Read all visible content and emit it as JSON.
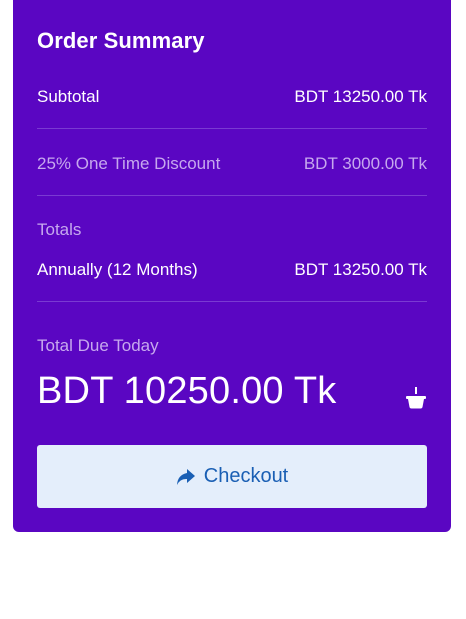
{
  "summary": {
    "title": "Order Summary",
    "subtotal": {
      "label": "Subtotal",
      "amount": "BDT 13250.00 Tk"
    },
    "discount": {
      "label": "25% One Time Discount",
      "amount": "BDT 3000.00 Tk"
    },
    "totals_label": "Totals",
    "annual": {
      "label": "Annually (12 Months)",
      "amount": "BDT 13250.00 Tk"
    },
    "due_label": "Total Due Today",
    "due_amount": "BDT 10250.00 Tk",
    "basket_icon": "basket-icon",
    "checkout_label": "Checkout",
    "checkout_icon": "share-arrow-icon"
  },
  "colors": {
    "card_bg": "#5a06c2",
    "muted_text": "#c6a8ee",
    "button_bg": "#e4eefb",
    "button_text": "#1a5fb4"
  }
}
